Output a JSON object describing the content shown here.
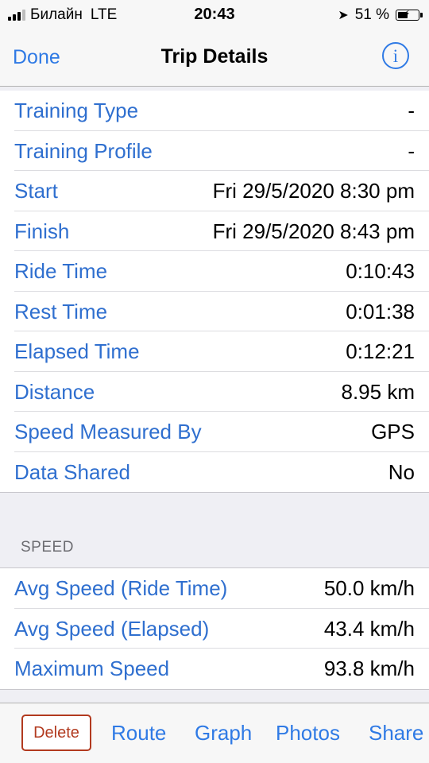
{
  "status_bar": {
    "carrier": "Билайн",
    "network": "LTE",
    "time": "20:43",
    "battery_percent": "51 %",
    "battery_level": 0.51
  },
  "nav": {
    "done_label": "Done",
    "title": "Trip Details",
    "info_glyph": "i"
  },
  "details": [
    {
      "label": "Training Type",
      "value": "-"
    },
    {
      "label": "Training Profile",
      "value": "-"
    },
    {
      "label": "Start",
      "value": "Fri 29/5/2020 8:30 pm"
    },
    {
      "label": "Finish",
      "value": "Fri 29/5/2020 8:43 pm"
    },
    {
      "label": "Ride Time",
      "value": "0:10:43"
    },
    {
      "label": "Rest Time",
      "value": "0:01:38"
    },
    {
      "label": "Elapsed Time",
      "value": "0:12:21"
    },
    {
      "label": "Distance",
      "value": "8.95 km"
    },
    {
      "label": "Speed Measured By",
      "value": "GPS"
    },
    {
      "label": "Data Shared",
      "value": "No"
    }
  ],
  "speed_section": {
    "header": "SPEED",
    "rows": [
      {
        "label": "Avg Speed (Ride Time)",
        "value": "50.0 km/h"
      },
      {
        "label": "Avg Speed (Elapsed)",
        "value": "43.4 km/h"
      },
      {
        "label": "Maximum Speed",
        "value": "93.8 km/h"
      }
    ]
  },
  "toolbar": {
    "delete_label": "Delete",
    "route_label": "Route",
    "graph_label": "Graph",
    "photos_label": "Photos",
    "share_label": "Share"
  },
  "colors": {
    "accent": "#2f7ae5",
    "label_blue": "#2f6fcf",
    "delete_red": "#b23a1f"
  }
}
